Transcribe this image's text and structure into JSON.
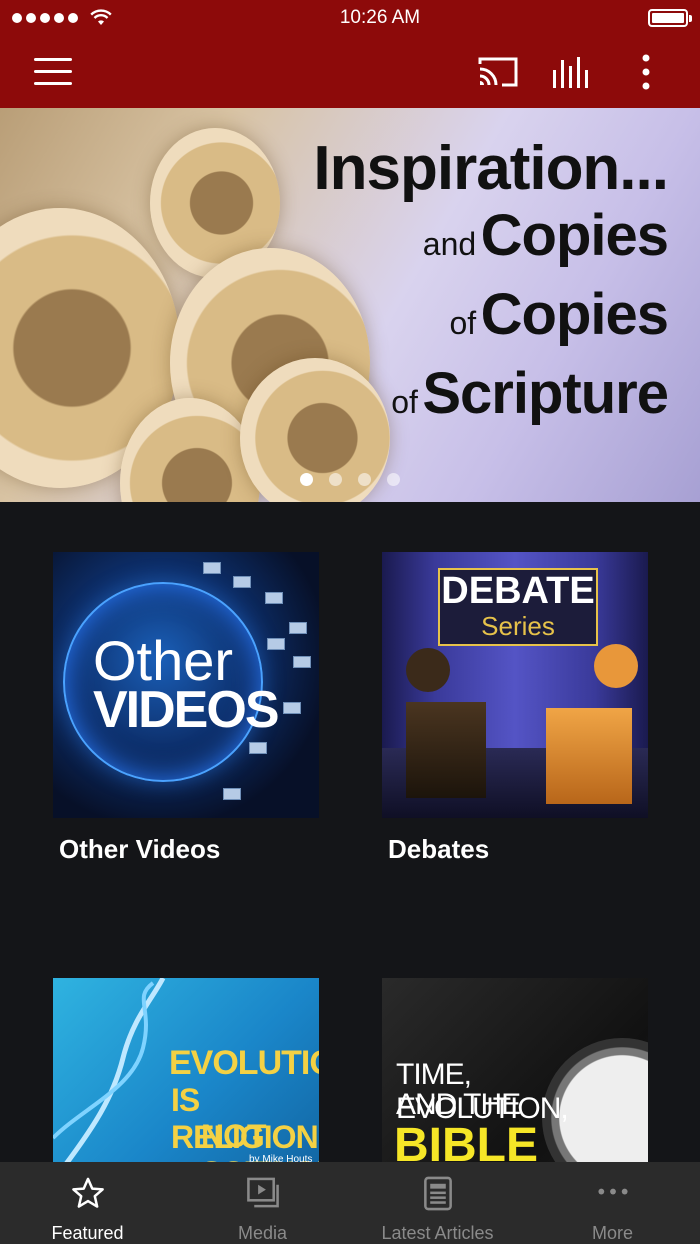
{
  "status_bar": {
    "time": "10:26 AM"
  },
  "app_bar": {
    "menu_icon": "hamburger-menu-icon",
    "cast_icon": "cast-icon",
    "audio_icon": "audio-bars-icon",
    "more_icon": "vertical-dots-icon"
  },
  "hero": {
    "line1": "Inspiration...",
    "line2_small": "and",
    "line2_big": "Copies",
    "line3_small": "of",
    "line3_big": "Copies",
    "line4_small": "of",
    "line4_big": "Scripture",
    "page_count": 4,
    "active_page": 1
  },
  "tiles": [
    {
      "label": "Other Videos",
      "thumb_text_1": "Other",
      "thumb_text_2": "VIDEOS"
    },
    {
      "label": "Debates",
      "thumb_text_1": "DEBATE",
      "thumb_text_2": "Series"
    },
    {
      "thumb_text_1": "EVOLUTION",
      "thumb_text_2": "IS RELIGION,",
      "thumb_text_3": "NOT SCIENCE",
      "thumb_text_4": "by Mike Houts"
    },
    {
      "thumb_text_1": "TIME, EVOLUTION,",
      "thumb_text_2": "AND THE",
      "thumb_text_3": "BIBLE"
    }
  ],
  "tab_bar": {
    "tabs": [
      {
        "label": "Featured",
        "icon": "star-icon",
        "active": true
      },
      {
        "label": "Media",
        "icon": "media-play-icon",
        "active": false
      },
      {
        "label": "Latest Articles",
        "icon": "article-icon",
        "active": false
      },
      {
        "label": "More",
        "icon": "more-dots-icon",
        "active": false
      }
    ]
  },
  "colors": {
    "brand": "#8d0a0a",
    "background": "#141518",
    "tab_bar": "#2b2b2b"
  }
}
